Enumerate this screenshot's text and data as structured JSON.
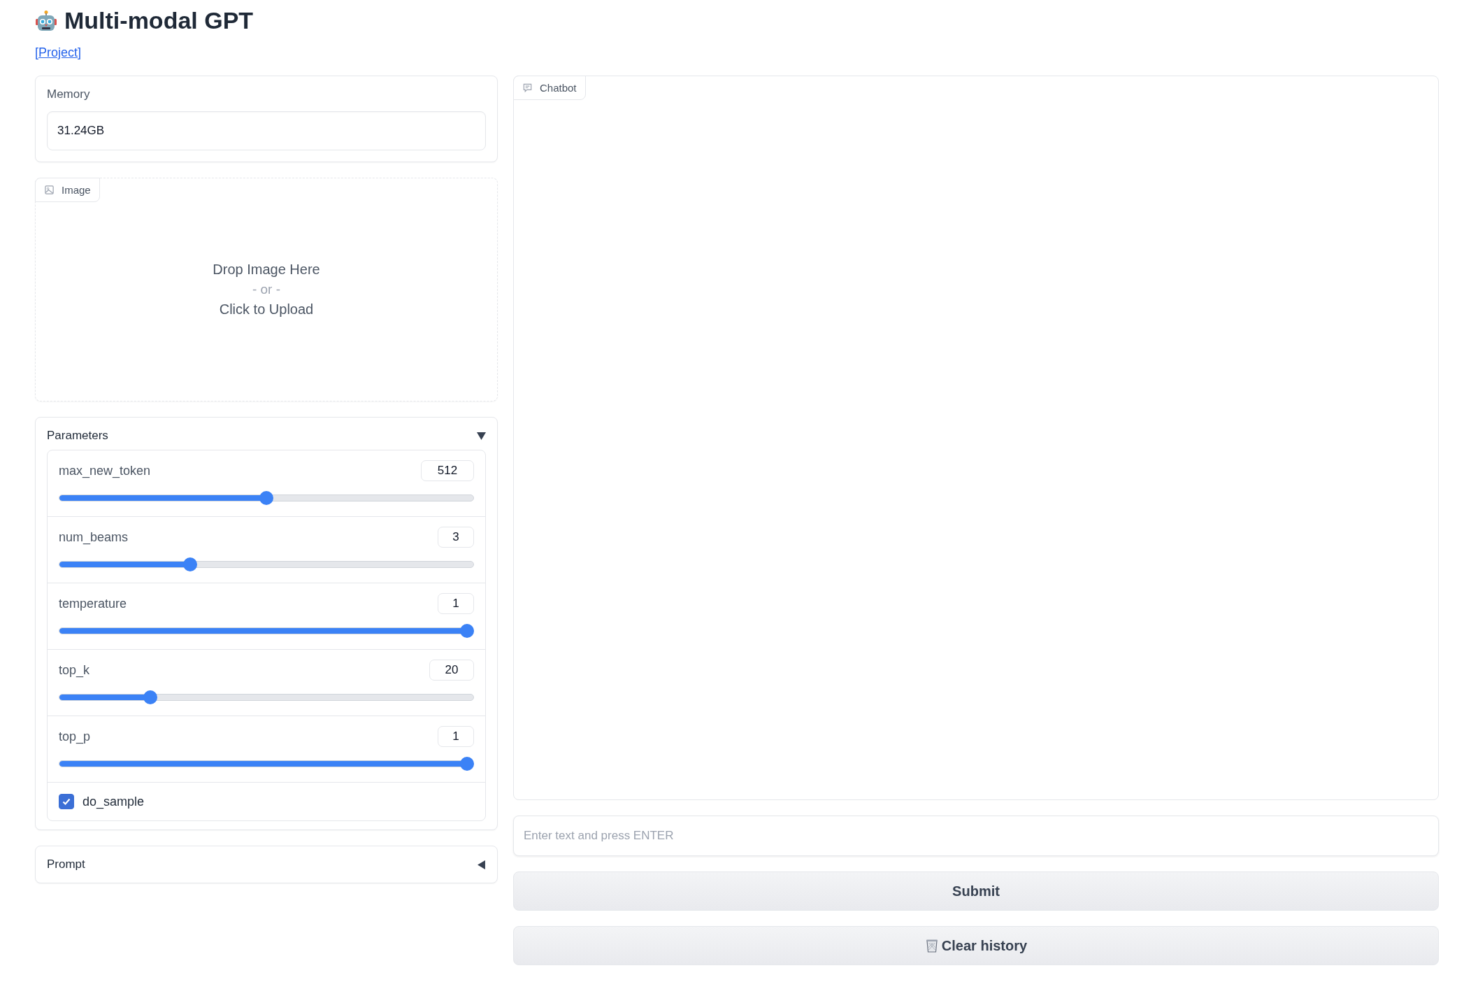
{
  "title": "Multi-modal GPT",
  "project_link": "[Project]",
  "memory": {
    "label": "Memory",
    "value": "31.24GB"
  },
  "image": {
    "label": "Image",
    "drop_text": "Drop Image Here",
    "or_text": "- or -",
    "upload_text": "Click to Upload"
  },
  "parameters": {
    "title": "Parameters",
    "expanded": true,
    "sliders": [
      {
        "name": "max_new_token",
        "value": "512",
        "level": 0.5
      },
      {
        "name": "num_beams",
        "value": "3",
        "level": 0.31
      },
      {
        "name": "temperature",
        "value": "1",
        "level": 1
      },
      {
        "name": "top_k",
        "value": "20",
        "level": 0.21
      },
      {
        "name": "top_p",
        "value": "1",
        "level": 1
      }
    ],
    "checkbox": {
      "label": "do_sample",
      "checked": true
    }
  },
  "prompt": {
    "title": "Prompt",
    "expanded": false
  },
  "chatbot": {
    "label": "Chatbot"
  },
  "input": {
    "placeholder": "Enter text and press ENTER"
  },
  "buttons": [
    {
      "label": "Submit",
      "kind": "plain"
    },
    {
      "label": "Clear history",
      "kind": "trash"
    }
  ]
}
